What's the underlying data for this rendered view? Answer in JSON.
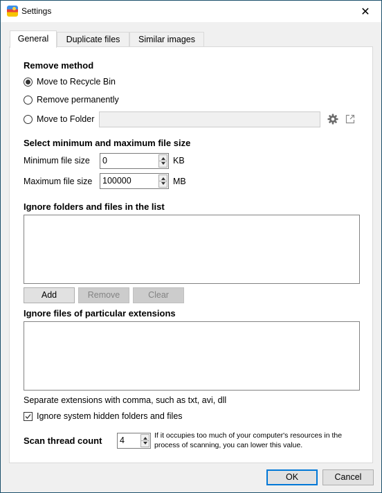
{
  "window": {
    "title": "Settings",
    "app_icon": "app-photo-icon",
    "close_icon": "close-icon",
    "close_glyph": "✕"
  },
  "tabs": [
    {
      "label": "General",
      "active": true
    },
    {
      "label": "Duplicate files",
      "active": false
    },
    {
      "label": "Similar images",
      "active": false
    }
  ],
  "general": {
    "remove_method": {
      "title": "Remove method",
      "options": [
        {
          "label": "Move to Recycle Bin",
          "checked": true
        },
        {
          "label": "Remove permanently",
          "checked": false
        },
        {
          "label": "Move to Folder",
          "checked": false
        }
      ],
      "folder_path": "",
      "gear_icon": "gear-icon",
      "open_icon": "open-external-icon"
    },
    "file_size": {
      "title": "Select minimum and maximum file size",
      "min_label": "Minimum file size",
      "min_value": "0",
      "min_unit": "KB",
      "max_label": "Maximum file size",
      "max_value": "100000",
      "max_unit": "MB"
    },
    "ignore_list": {
      "title": "Ignore folders and files in the list",
      "items": [],
      "add_label": "Add",
      "remove_label": "Remove",
      "clear_label": "Clear"
    },
    "ignore_extensions": {
      "title": "Ignore files of particular extensions",
      "value": "",
      "hint": "Separate extensions with comma, such as txt, avi, dll"
    },
    "ignore_hidden": {
      "label": "Ignore system hidden folders and files",
      "checked": true
    },
    "thread_count": {
      "label": "Scan thread count",
      "value": "4",
      "hint_line1": "If it occupies too much of your computer's resources in the",
      "hint_line2": "process of scanning, you can lower this value."
    }
  },
  "footer": {
    "ok_label": "OK",
    "cancel_label": "Cancel"
  },
  "colors": {
    "accent": "#0078d7",
    "window_border": "#1b4f6b",
    "background": "#f0f0f0"
  }
}
